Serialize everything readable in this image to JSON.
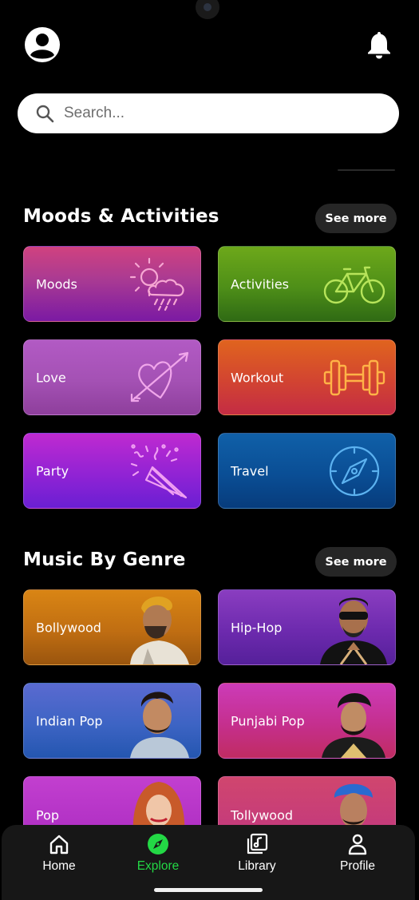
{
  "search": {
    "placeholder": "Search..."
  },
  "moods_section": {
    "title": "Moods & Activities",
    "see_more": "See more",
    "tiles": [
      {
        "label": "Moods",
        "icon": "sun-cloud-rain-icon"
      },
      {
        "label": "Activities",
        "icon": "bicycle-icon"
      },
      {
        "label": "Love",
        "icon": "heart-arrow-icon"
      },
      {
        "label": "Workout",
        "icon": "dumbbell-icon"
      },
      {
        "label": "Party",
        "icon": "party-popper-icon"
      },
      {
        "label": "Travel",
        "icon": "compass-icon"
      }
    ]
  },
  "genre_section": {
    "title": "Music By Genre",
    "see_more": "See more",
    "tiles": [
      {
        "label": "Bollywood"
      },
      {
        "label": "Hip-Hop"
      },
      {
        "label": "Indian Pop"
      },
      {
        "label": "Punjabi Pop"
      },
      {
        "label": "Pop"
      },
      {
        "label": "Tollywood"
      }
    ]
  },
  "nav": {
    "items": [
      {
        "label": "Home",
        "icon": "home-icon"
      },
      {
        "label": "Explore",
        "icon": "compass-icon",
        "active": true
      },
      {
        "label": "Library",
        "icon": "library-icon"
      },
      {
        "label": "Profile",
        "icon": "user-icon"
      }
    ]
  },
  "colors": {
    "background": "#000000",
    "accent": "#23d845",
    "pill": "#262626",
    "nav_bg": "#171717"
  }
}
